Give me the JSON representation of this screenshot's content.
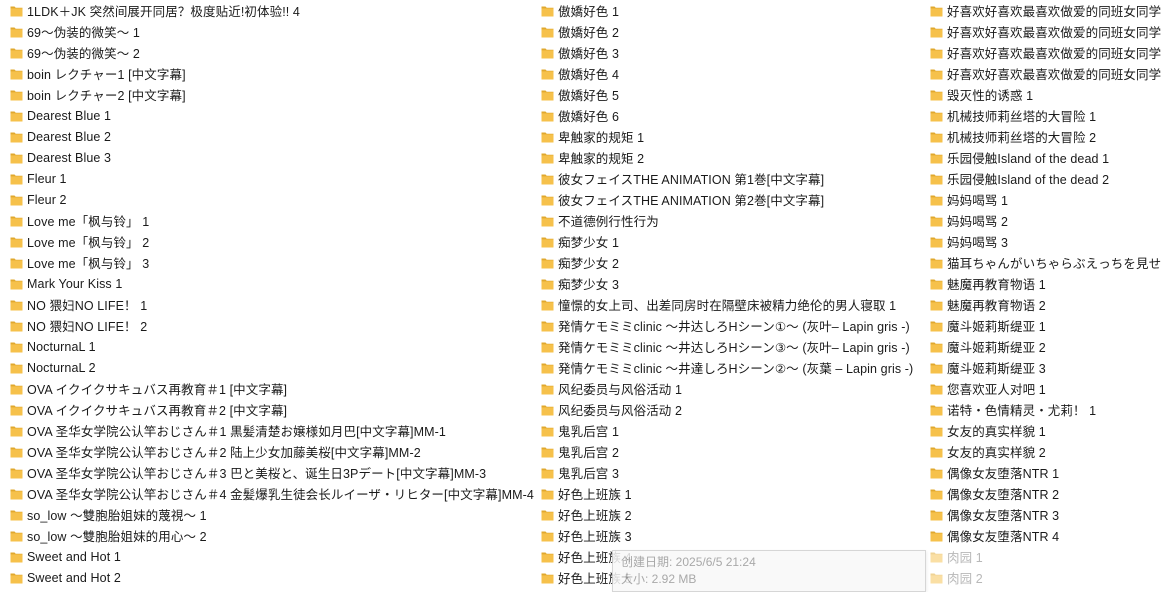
{
  "colors": {
    "folder": "#f6c14b",
    "folder_dark": "#e0a82e",
    "text": "#1a1a1a",
    "faded": "#b8b8b8"
  },
  "icon": "folder-icon",
  "columns": [
    [
      "1LDK＋JK 突然间展开同居？极度贴近!初体验!! 4",
      "69～伪装的微笑～ 1",
      "69～伪装的微笑～ 2",
      "boin レクチャー1 [中文字幕]",
      "boin レクチャー2 [中文字幕]",
      "Dearest Blue 1",
      "Dearest Blue 2",
      "Dearest Blue 3",
      "Fleur 1",
      "Fleur 2",
      "Love me「枫与铃」 1",
      "Love me「枫与铃」 2",
      "Love me「枫与铃」 3",
      "Mark Your Kiss 1",
      "NO 猥妇NO LIFE！ 1",
      "NO 猥妇NO LIFE！ 2",
      "NocturnaL 1",
      "NocturnaL 2",
      "OVA イクイクサキュバス再教育＃1 [中文字幕]",
      "OVA イクイクサキュバス再教育＃2 [中文字幕]",
      "OVA 圣华女学院公认竿おじさん＃1 黒髪清楚お嬢様如月巴[中文字幕]MM-1",
      "OVA 圣华女学院公认竿おじさん＃2 陆上少女加藤美桜[中文字幕]MM-2",
      "OVA 圣华女学院公认竿おじさん＃3 巴と美桜と、诞生日3Pデート[中文字幕]MM-3",
      "OVA 圣华女学院公认竿おじさん＃4 金髪爆乳生徒会长ルイーザ・リヒター[中文字幕]MM-4",
      "so_low ～雙胞胎姐妹的蔑視～ 1",
      "so_low ～雙胞胎姐妹的用心～ 2",
      "Sweet and Hot 1",
      "Sweet and Hot 2"
    ],
    [
      "傲嬌好色 1",
      "傲嬌好色 2",
      "傲嬌好色 3",
      "傲嬌好色 4",
      "傲嬌好色 5",
      "傲嬌好色 6",
      "卑触家的规矩 1",
      "卑触家的规矩 2",
      "彼女フェイスTHE ANIMATION 第1巻[中文字幕]",
      "彼女フェイスTHE ANIMATION 第2巻[中文字幕]",
      "不道德例行性行为",
      "痴梦少女 1",
      "痴梦少女 2",
      "痴梦少女 3",
      "憧憬的女上司、出差同房时在隔壁床被精力绝伦的男人寝取 1",
      "発情ケモミミclinic ～井达しろHシーン①～ (灰叶– Lapin gris -)",
      "発情ケモミミclinic ～井达しろHシーン③～ (灰叶– Lapin gris -)",
      "発情ケモミミclinic ～井達しろHシーン②～ (灰葉 – Lapin gris -)",
      "风纪委员与风俗活动 1",
      "风纪委员与风俗活动 2",
      "鬼乳后宫 1",
      "鬼乳后宫 2",
      "鬼乳后宫 3",
      "好色上班族 1",
      "好色上班族 2",
      "好色上班族 3",
      "好色上班族 4",
      "好色上班族 5"
    ],
    [
      "好喜欢好喜欢最喜欢做爱的同班女同学",
      "好喜欢好喜欢最喜欢做爱的同班女同学",
      "好喜欢好喜欢最喜欢做爱的同班女同学",
      "好喜欢好喜欢最喜欢做爱的同班女同学",
      "毁灭性的诱惑 1",
      "机械技师莉丝塔的大冒险 1",
      "机械技师莉丝塔的大冒险 2",
      "乐园侵触Island of the dead 1",
      "乐园侵触Island of the dead 2",
      "妈妈喝骂 1",
      "妈妈喝骂 2",
      "妈妈喝骂 3",
      "猫耳ちゃんがいちゃらぶえっちを見せ",
      "魅魔再教育物语 1",
      "魅魔再教育物语 2",
      "魔斗姬莉斯缇亚 1",
      "魔斗姬莉斯缇亚 2",
      "魔斗姬莉斯缇亚 3",
      "您喜欢亚人对吧 1",
      "诺特・色情精灵・尤莉！ 1",
      "女友的真实样貌 1",
      "女友的真实样貌 2",
      "偶像女友堕落NTR 1",
      "偶像女友堕落NTR 2",
      "偶像女友堕落NTR 3",
      "偶像女友堕落NTR 4",
      "肉园 1",
      "肉园 2"
    ]
  ],
  "tooltip": {
    "created": "创建日期: 2025/6/5 21:24",
    "size": "大小: 2.92 MB"
  }
}
